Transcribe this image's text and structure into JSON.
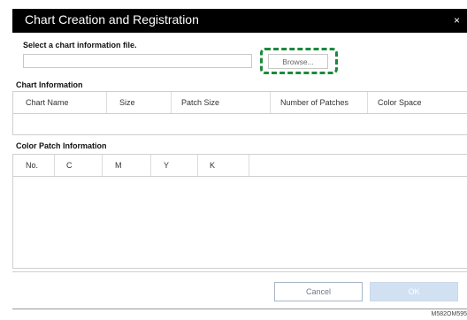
{
  "dialog": {
    "title": "Chart Creation and Registration",
    "close_glyph": "×"
  },
  "file_select": {
    "label": "Select a chart information file.",
    "value": "",
    "browse_label": "Browse..."
  },
  "chart_info": {
    "label": "Chart Information",
    "columns": [
      "Chart Name",
      "Size",
      "Patch Size",
      "Number of Patches",
      "Color Space"
    ]
  },
  "patch_info": {
    "label": "Color Patch Information",
    "columns": [
      "No.",
      "C",
      "M",
      "Y",
      "K"
    ]
  },
  "buttons": {
    "cancel": "Cancel",
    "ok": "OK"
  },
  "caption": "M582OM595",
  "colors": {
    "titlebar": "#000000",
    "highlight_outline": "#1a8a3a",
    "ok_disabled": "#d2e1f2"
  }
}
